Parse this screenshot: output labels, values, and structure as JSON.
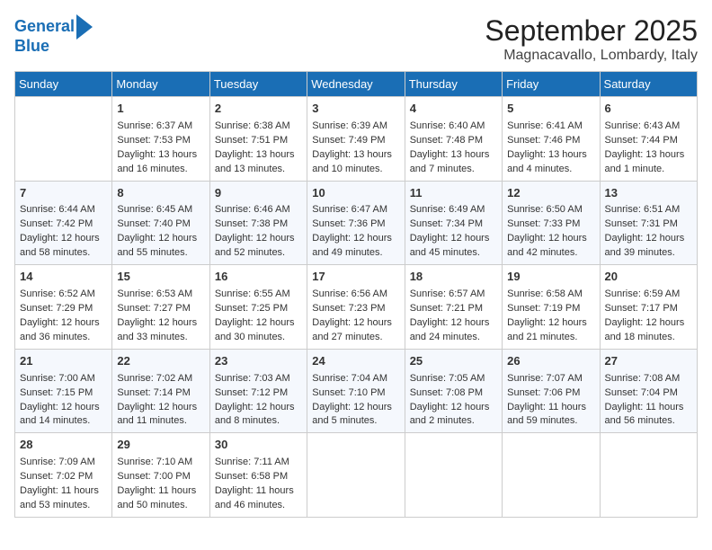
{
  "header": {
    "logo_line1": "General",
    "logo_line2": "Blue",
    "title": "September 2025",
    "subtitle": "Magnacavallo, Lombardy, Italy"
  },
  "weekdays": [
    "Sunday",
    "Monday",
    "Tuesday",
    "Wednesday",
    "Thursday",
    "Friday",
    "Saturday"
  ],
  "weeks": [
    [
      {
        "day": "",
        "text": ""
      },
      {
        "day": "1",
        "text": "Sunrise: 6:37 AM\nSunset: 7:53 PM\nDaylight: 13 hours\nand 16 minutes."
      },
      {
        "day": "2",
        "text": "Sunrise: 6:38 AM\nSunset: 7:51 PM\nDaylight: 13 hours\nand 13 minutes."
      },
      {
        "day": "3",
        "text": "Sunrise: 6:39 AM\nSunset: 7:49 PM\nDaylight: 13 hours\nand 10 minutes."
      },
      {
        "day": "4",
        "text": "Sunrise: 6:40 AM\nSunset: 7:48 PM\nDaylight: 13 hours\nand 7 minutes."
      },
      {
        "day": "5",
        "text": "Sunrise: 6:41 AM\nSunset: 7:46 PM\nDaylight: 13 hours\nand 4 minutes."
      },
      {
        "day": "6",
        "text": "Sunrise: 6:43 AM\nSunset: 7:44 PM\nDaylight: 13 hours\nand 1 minute."
      }
    ],
    [
      {
        "day": "7",
        "text": "Sunrise: 6:44 AM\nSunset: 7:42 PM\nDaylight: 12 hours\nand 58 minutes."
      },
      {
        "day": "8",
        "text": "Sunrise: 6:45 AM\nSunset: 7:40 PM\nDaylight: 12 hours\nand 55 minutes."
      },
      {
        "day": "9",
        "text": "Sunrise: 6:46 AM\nSunset: 7:38 PM\nDaylight: 12 hours\nand 52 minutes."
      },
      {
        "day": "10",
        "text": "Sunrise: 6:47 AM\nSunset: 7:36 PM\nDaylight: 12 hours\nand 49 minutes."
      },
      {
        "day": "11",
        "text": "Sunrise: 6:49 AM\nSunset: 7:34 PM\nDaylight: 12 hours\nand 45 minutes."
      },
      {
        "day": "12",
        "text": "Sunrise: 6:50 AM\nSunset: 7:33 PM\nDaylight: 12 hours\nand 42 minutes."
      },
      {
        "day": "13",
        "text": "Sunrise: 6:51 AM\nSunset: 7:31 PM\nDaylight: 12 hours\nand 39 minutes."
      }
    ],
    [
      {
        "day": "14",
        "text": "Sunrise: 6:52 AM\nSunset: 7:29 PM\nDaylight: 12 hours\nand 36 minutes."
      },
      {
        "day": "15",
        "text": "Sunrise: 6:53 AM\nSunset: 7:27 PM\nDaylight: 12 hours\nand 33 minutes."
      },
      {
        "day": "16",
        "text": "Sunrise: 6:55 AM\nSunset: 7:25 PM\nDaylight: 12 hours\nand 30 minutes."
      },
      {
        "day": "17",
        "text": "Sunrise: 6:56 AM\nSunset: 7:23 PM\nDaylight: 12 hours\nand 27 minutes."
      },
      {
        "day": "18",
        "text": "Sunrise: 6:57 AM\nSunset: 7:21 PM\nDaylight: 12 hours\nand 24 minutes."
      },
      {
        "day": "19",
        "text": "Sunrise: 6:58 AM\nSunset: 7:19 PM\nDaylight: 12 hours\nand 21 minutes."
      },
      {
        "day": "20",
        "text": "Sunrise: 6:59 AM\nSunset: 7:17 PM\nDaylight: 12 hours\nand 18 minutes."
      }
    ],
    [
      {
        "day": "21",
        "text": "Sunrise: 7:00 AM\nSunset: 7:15 PM\nDaylight: 12 hours\nand 14 minutes."
      },
      {
        "day": "22",
        "text": "Sunrise: 7:02 AM\nSunset: 7:14 PM\nDaylight: 12 hours\nand 11 minutes."
      },
      {
        "day": "23",
        "text": "Sunrise: 7:03 AM\nSunset: 7:12 PM\nDaylight: 12 hours\nand 8 minutes."
      },
      {
        "day": "24",
        "text": "Sunrise: 7:04 AM\nSunset: 7:10 PM\nDaylight: 12 hours\nand 5 minutes."
      },
      {
        "day": "25",
        "text": "Sunrise: 7:05 AM\nSunset: 7:08 PM\nDaylight: 12 hours\nand 2 minutes."
      },
      {
        "day": "26",
        "text": "Sunrise: 7:07 AM\nSunset: 7:06 PM\nDaylight: 11 hours\nand 59 minutes."
      },
      {
        "day": "27",
        "text": "Sunrise: 7:08 AM\nSunset: 7:04 PM\nDaylight: 11 hours\nand 56 minutes."
      }
    ],
    [
      {
        "day": "28",
        "text": "Sunrise: 7:09 AM\nSunset: 7:02 PM\nDaylight: 11 hours\nand 53 minutes."
      },
      {
        "day": "29",
        "text": "Sunrise: 7:10 AM\nSunset: 7:00 PM\nDaylight: 11 hours\nand 50 minutes."
      },
      {
        "day": "30",
        "text": "Sunrise: 7:11 AM\nSunset: 6:58 PM\nDaylight: 11 hours\nand 46 minutes."
      },
      {
        "day": "",
        "text": ""
      },
      {
        "day": "",
        "text": ""
      },
      {
        "day": "",
        "text": ""
      },
      {
        "day": "",
        "text": ""
      }
    ]
  ]
}
